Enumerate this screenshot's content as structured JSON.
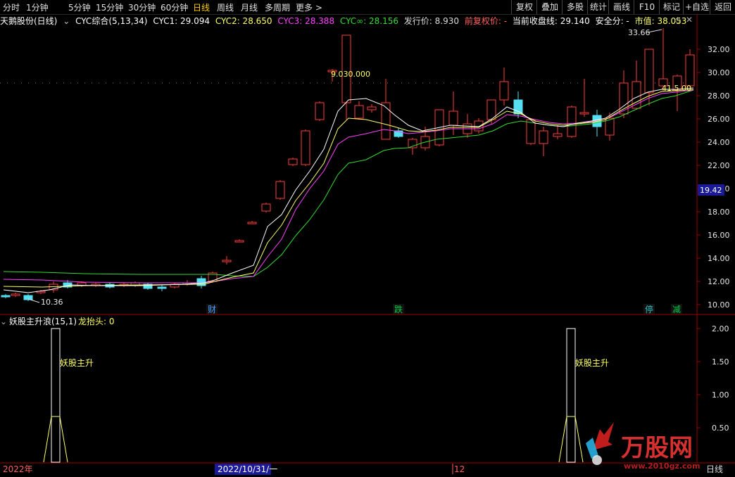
{
  "toolbar": {
    "periods": [
      "分时",
      "1分钟",
      "5分钟",
      "15分钟",
      "30分钟",
      "60分钟",
      "日线",
      "周线",
      "月线",
      "多周期",
      "更多 >"
    ],
    "active_period": "日线",
    "right_buttons": [
      "复权",
      "叠加",
      "多股",
      "统计",
      "画线",
      "F10",
      "标记",
      "+自选",
      "返回"
    ]
  },
  "info": {
    "stock_name": "天鹅股份(日线)",
    "indicator": "CYC综合(5,13,34)",
    "cyc1": "CYC1: 29.094",
    "cyc2": "CYC2: 28.650",
    "cyc3": "CYC3: 28.388",
    "cyc_inf": "CYC∞: 28.156",
    "issue_price": "发行价: 8.930",
    "pre_adjust": "前复权价: -",
    "cur_close_line": "当前收盘线: 29.140",
    "safety": "安全分: -",
    "market_value": "市值: 38.053"
  },
  "price_axis": {
    "ticks": [
      "32.00",
      "30.00",
      "28.00",
      "26.00",
      "24.00",
      "22.00",
      "20.00",
      "18.00",
      "16.00",
      "14.00",
      "12.00",
      "10.00"
    ],
    "current_price": "19.42"
  },
  "annotations": {
    "high_label": "33.66",
    "low_label": "10.36",
    "dotted_label": "9.030.000",
    "right_label": "41.5.00"
  },
  "event_markers": [
    {
      "text": "财",
      "color": "#4aa0ff"
    },
    {
      "text": "跌",
      "color": "#00cc44"
    },
    {
      "text": "停",
      "color": "#30c0c0"
    },
    {
      "text": "减",
      "color": "#00cc44"
    }
  ],
  "sub_panel": {
    "title": "妖股主升浪(15,1)",
    "value": "龙抬头: 0",
    "signal_text": "妖股主升",
    "ticks": [
      "2.00",
      "1.50",
      "1.00",
      "0.50"
    ]
  },
  "date_axis": {
    "start": "2022年",
    "cursor_date": "2022/10/31/一",
    "month": "12",
    "right": "日线"
  },
  "watermark": {
    "brand": "万股网",
    "url": "www.2010gz.com"
  },
  "colors": {
    "up": "#ff3b3b",
    "down": "#54e0f0",
    "cyc1": "#ffffff",
    "cyc2": "#ffff66",
    "cyc3": "#ff40ff",
    "cyc_inf": "#33dd33",
    "grid_border": "#9b0000"
  }
}
